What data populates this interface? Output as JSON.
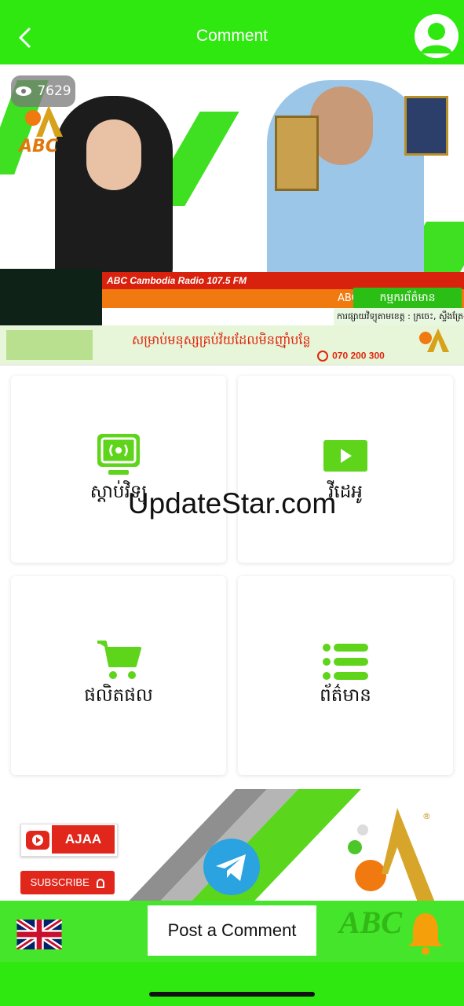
{
  "header": {
    "title": "Comment",
    "back_icon": "chevron-left-icon",
    "profile_icon": "user-avatar-icon",
    "color": "#2ee80f"
  },
  "video": {
    "view_count": "7629",
    "view_icon": "eye-icon",
    "radio_label": "ABC Cambodia Radio 107.5 FM",
    "abc_tag": "ABC",
    "kh_label": "កម្មករព័ត៌មាន",
    "ticker_text": "ការផ្សាយវិទ្យុតាមខេត្ត : ក្រចេះ, ស្ទឹងត្រែង"
  },
  "banner": {
    "text": "សម្រាប់មនុស្សគ្រប់វ័យដែលមិនញ៉ាំបន្លែ",
    "phone": "070 200 300"
  },
  "grid": [
    {
      "label": "ស្តាប់វិទ្យុ",
      "icon": "radio-broadcast-icon"
    },
    {
      "label": "វីដេអូ",
      "icon": "video-play-icon"
    },
    {
      "label": "ផលិតផល",
      "icon": "shopping-cart-icon"
    },
    {
      "label": "ព័ត៌មាន",
      "icon": "list-icon"
    }
  ],
  "watermark": "UpdateStar.com",
  "promo": {
    "channel_name": "AJAA",
    "subscribe_label": "SUBSCRIBE",
    "brand": "ABC",
    "registered": "®"
  },
  "bottom_bar": {
    "post_comment_label": "Post a Comment",
    "flag_icon": "uk-flag-icon",
    "bell_icon": "bell-icon",
    "telegram_icon": "telegram-icon"
  },
  "colors": {
    "accent": "#2ee80f",
    "card_icon": "#5ed41a",
    "red": "#e1261c"
  }
}
